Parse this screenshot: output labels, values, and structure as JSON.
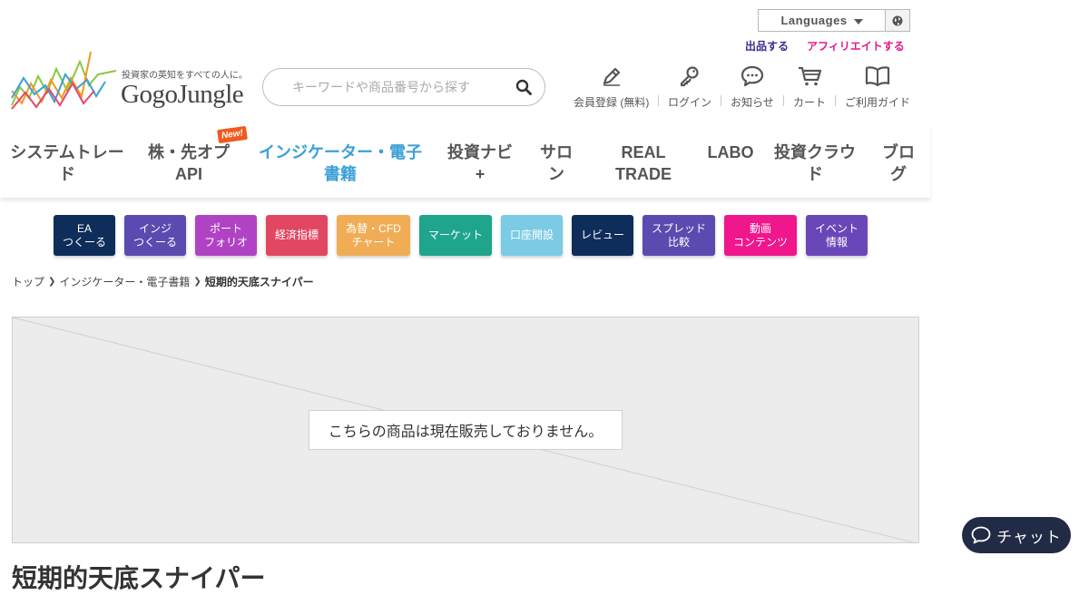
{
  "header": {
    "languages_label": "Languages",
    "sell_link": "出品する",
    "affiliate_link": "アフィリエイトする",
    "logo_tagline": "投資家の英知をすべての人に。",
    "logo_name": "GogoJungle",
    "search_placeholder": "キーワードや商品番号から探す",
    "utilities": [
      {
        "label": "会員登録 (無料)",
        "icon": "pencil-icon"
      },
      {
        "label": "ログイン",
        "icon": "key-icon"
      },
      {
        "label": "お知らせ",
        "icon": "chat-bubble-icon"
      },
      {
        "label": "カート",
        "icon": "cart-icon"
      },
      {
        "label": "ご利用ガイド",
        "icon": "book-icon"
      }
    ]
  },
  "nav": {
    "new_badge": "New!",
    "items": [
      {
        "label": "システムトレード"
      },
      {
        "label": "株・先オプAPI"
      },
      {
        "label": "インジケーター・電子書籍",
        "active": true
      },
      {
        "label": "投資ナビ+"
      },
      {
        "label": "サロン"
      },
      {
        "label": "REAL TRADE"
      },
      {
        "label": "LABO"
      },
      {
        "label": "投資クラウド"
      },
      {
        "label": "ブログ"
      }
    ]
  },
  "categories": [
    {
      "label": "EA\nつくーる",
      "color": "#0f2d5a"
    },
    {
      "label": "インジ\nつくーる",
      "color": "#5b4ab0"
    },
    {
      "label": "ポート\nフォリオ",
      "color": "#b043c4"
    },
    {
      "label": "経済指標",
      "color": "#e24762"
    },
    {
      "label": "為替・CFD\nチャート",
      "color": "#f0ad55"
    },
    {
      "label": "マーケット",
      "color": "#1ea58c"
    },
    {
      "label": "口座開設",
      "color": "#7acbe3"
    },
    {
      "label": "レビュー",
      "color": "#0f2d5a"
    },
    {
      "label": "スプレッド\n比較",
      "color": "#5b4ab0"
    },
    {
      "label": "動画\nコンテンツ",
      "color": "#f0168c"
    },
    {
      "label": "イベント\n情報",
      "color": "#6a47b8"
    }
  ],
  "breadcrumb": {
    "items": [
      "トップ",
      "インジケーター・電子書籍"
    ],
    "current": "短期的天底スナイパー"
  },
  "product": {
    "notice": "こちらの商品は現在販売しておりません。",
    "title": "短期的天底スナイパー"
  },
  "chat": {
    "label": "チャット"
  },
  "colors": {
    "accent_blue": "#3aa0d8",
    "brand_purple": "#3b2d8f",
    "brand_pink": "#e3188c",
    "chat_bg": "#222b45"
  }
}
